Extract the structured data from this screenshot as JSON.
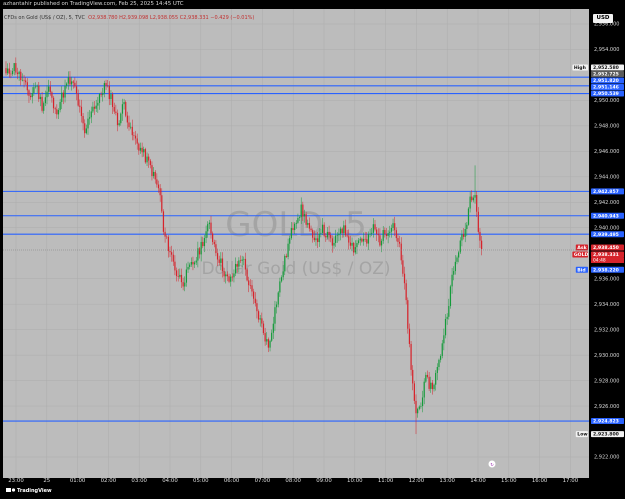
{
  "publisher_line": "azhantahir published on TradingView.com, Feb 25, 2025 14:45 UTC",
  "header": {
    "title": "CFDs on Gold (US$ / OZ), 5, TVC",
    "ohlc": "O2,938.780  H2,939.098  L2,938.055  C2,938.331  −0.429 (−0.01%)"
  },
  "currency_button": "USD",
  "watermark": {
    "symbol": "GOLD, 5",
    "name": "Dollar Gold (US$ / OZ)"
  },
  "branding": "TradingView",
  "colors": {
    "bull": "#149a3a",
    "bear": "#d6232b",
    "level_line": "#2962ff",
    "background": "#bcbcbc",
    "axis_bg": "#000000"
  },
  "chart_data": {
    "type": "candlestick",
    "symbol": "GOLD",
    "timeframe": "5",
    "ylim": [
      2922,
      2956
    ],
    "y_ticks": [
      "2,956.000",
      "2,954.000",
      "2,950.000",
      "2,948.000",
      "2,946.000",
      "2,944.000",
      "2,942.000",
      "2,940.000",
      "2,936.000",
      "2,934.000",
      "2,932.000",
      "2,930.000",
      "2,928.000",
      "2,926.000",
      "2,922.000"
    ],
    "x_ticks": [
      "23:00",
      "25",
      "01:00",
      "02:00",
      "03:00",
      "04:00",
      "05:00",
      "06:00",
      "07:00",
      "08:00",
      "09:00",
      "10:00",
      "11:00",
      "12:00",
      "13:00",
      "14:00",
      "15:00",
      "16:00",
      "17:00"
    ],
    "horizontal_levels": [
      2951.82,
      2951.146,
      2950.539,
      2942.857,
      2940.943,
      2939.495,
      2924.823
    ],
    "price_tags": [
      {
        "label": "High",
        "value": "2,952.580",
        "price": 2952.58
      },
      {
        "label": "",
        "value": "2,952.725",
        "price": 2952.725
      },
      {
        "label": "",
        "value": "2,951.820",
        "price": 2951.82
      },
      {
        "label": "",
        "value": "2,951.146",
        "price": 2951.146
      },
      {
        "label": "",
        "value": "2,950.539",
        "price": 2950.539
      },
      {
        "label": "",
        "value": "2,942.857",
        "price": 2942.857
      },
      {
        "label": "",
        "value": "2,940.943",
        "price": 2940.943
      },
      {
        "label": "",
        "value": "2,939.495",
        "price": 2939.495
      },
      {
        "label": "Ask",
        "value": "2,938.450",
        "price": 2938.45
      },
      {
        "label": "GOLD",
        "value": "2,938.331",
        "price": 2937.9,
        "sub": "04:48"
      },
      {
        "label": "Bid",
        "value": "2,938.220",
        "price": 2936.7
      },
      {
        "label": "",
        "value": "2,924.823",
        "price": 2924.823
      },
      {
        "label": "Low",
        "value": "2,923.800",
        "price": 2923.8
      }
    ],
    "last_price": 2938.331,
    "path_key_points": [
      [
        0,
        2952.0
      ],
      [
        5,
        2952.7
      ],
      [
        10,
        2951.5
      ],
      [
        15,
        2950.3
      ],
      [
        18,
        2951.3
      ],
      [
        22,
        2949.6
      ],
      [
        26,
        2951.0
      ],
      [
        30,
        2949.0
      ],
      [
        35,
        2950.6
      ],
      [
        38,
        2951.5
      ],
      [
        42,
        2951.0
      ],
      [
        48,
        2947.3
      ],
      [
        52,
        2949.4
      ],
      [
        56,
        2949.8
      ],
      [
        60,
        2951.2
      ],
      [
        64,
        2950.3
      ],
      [
        68,
        2948.2
      ],
      [
        72,
        2949.8
      ],
      [
        76,
        2947.5
      ],
      [
        82,
        2946.2
      ],
      [
        88,
        2944.8
      ],
      [
        94,
        2942.6
      ],
      [
        96,
        2939.6
      ],
      [
        100,
        2938.2
      ],
      [
        104,
        2936.4
      ],
      [
        108,
        2935.8
      ],
      [
        112,
        2936.8
      ],
      [
        116,
        2937.6
      ],
      [
        120,
        2939.0
      ],
      [
        124,
        2940.2
      ],
      [
        128,
        2938.2
      ],
      [
        132,
        2936.9
      ],
      [
        136,
        2935.6
      ],
      [
        140,
        2936.8
      ],
      [
        144,
        2937.8
      ],
      [
        148,
        2935.6
      ],
      [
        152,
        2933.8
      ],
      [
        156,
        2932.3
      ],
      [
        160,
        2930.6
      ],
      [
        164,
        2933.6
      ],
      [
        168,
        2936.2
      ],
      [
        172,
        2938.6
      ],
      [
        176,
        2940.6
      ],
      [
        180,
        2941.4
      ],
      [
        184,
        2940.3
      ],
      [
        188,
        2938.6
      ],
      [
        192,
        2940.0
      ],
      [
        196,
        2939.3
      ],
      [
        200,
        2938.6
      ],
      [
        204,
        2940.1
      ],
      [
        208,
        2939.5
      ],
      [
        212,
        2938.4
      ],
      [
        216,
        2939.2
      ],
      [
        220,
        2938.8
      ],
      [
        224,
        2940.0
      ],
      [
        228,
        2939.0
      ],
      [
        232,
        2939.8
      ],
      [
        236,
        2940.4
      ],
      [
        240,
        2938.4
      ],
      [
        244,
        2934.2
      ],
      [
        247,
        2928.6
      ],
      [
        250,
        2925.5
      ],
      [
        252,
        2925.9
      ],
      [
        256,
        2928.0
      ],
      [
        260,
        2927.5
      ],
      [
        264,
        2929.4
      ],
      [
        268,
        2932.6
      ],
      [
        272,
        2936.0
      ],
      [
        276,
        2938.4
      ],
      [
        280,
        2939.8
      ],
      [
        283,
        2942.4
      ],
      [
        286,
        2943.0
      ],
      [
        288,
        2939.8
      ],
      [
        290,
        2938.3
      ]
    ]
  }
}
